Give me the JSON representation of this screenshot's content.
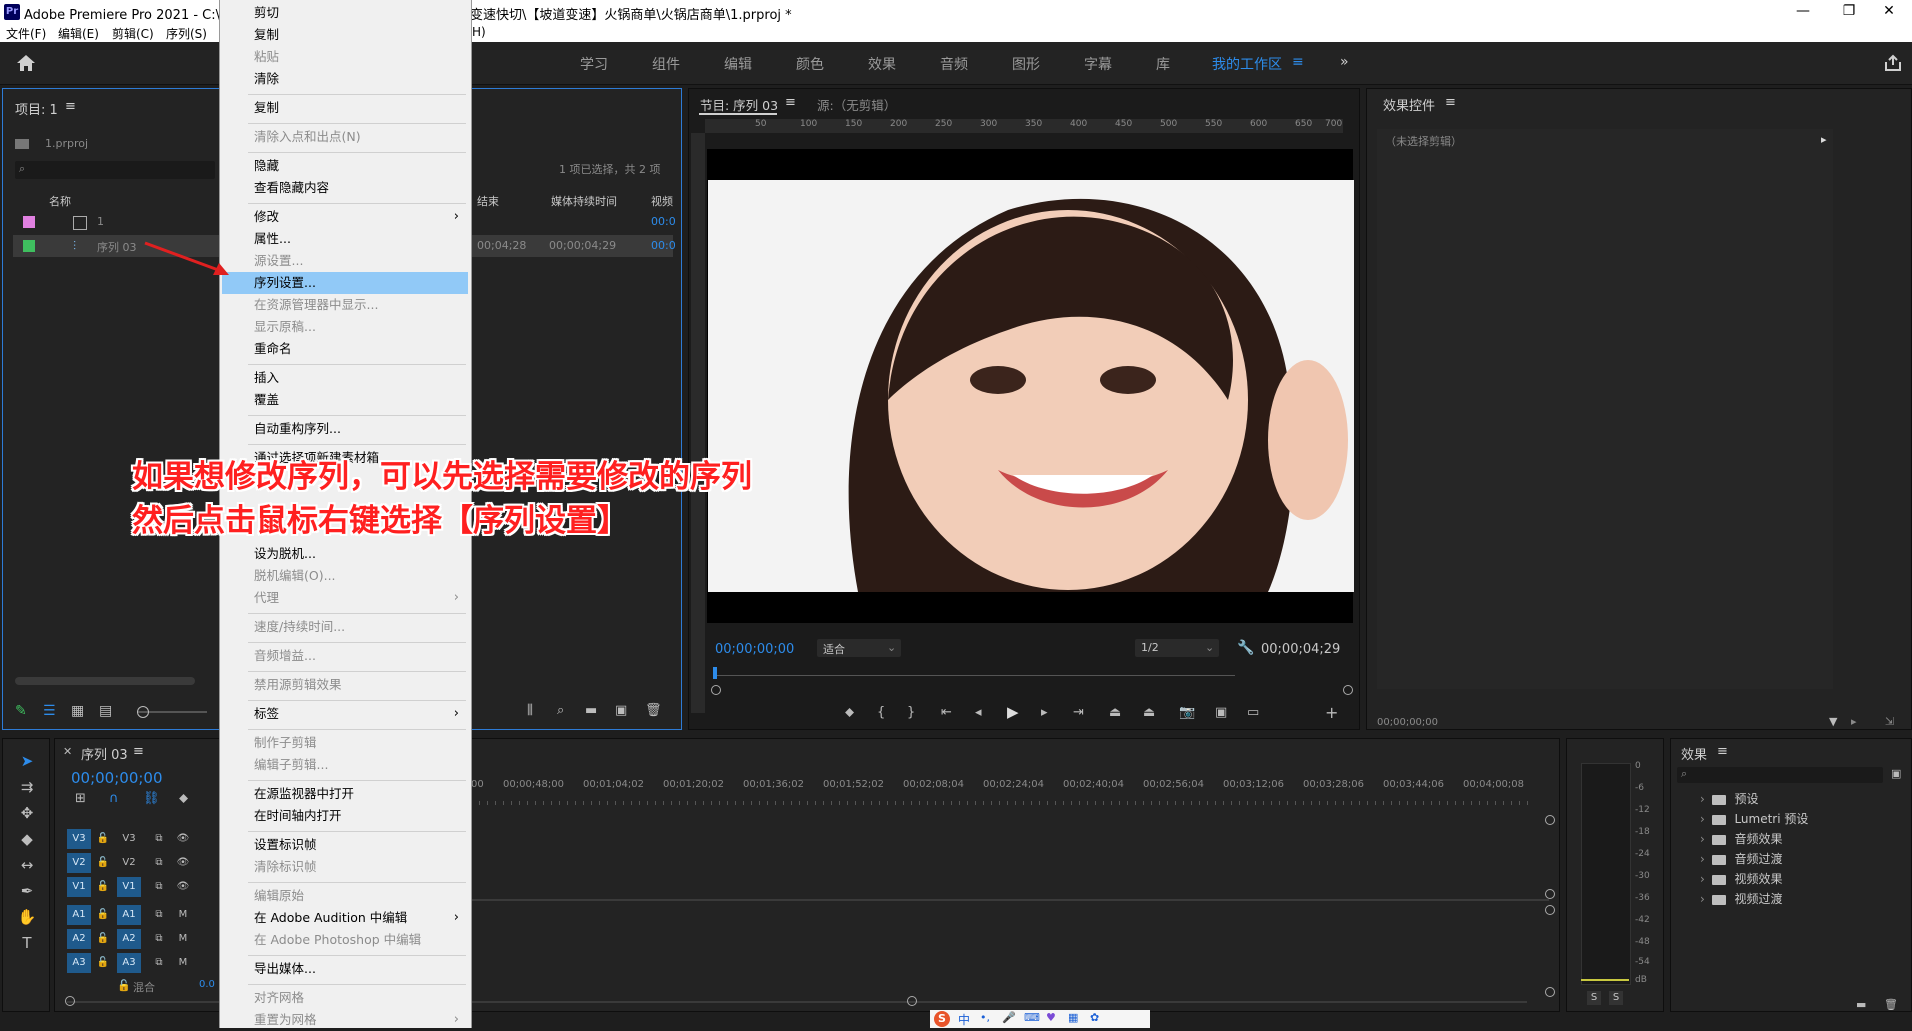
{
  "window": {
    "logo": "Pr",
    "title_left": "Adobe Premiere Pro 2021 - C:\\用/",
    "title_right": "变速快切\\【坡道变速】火锅商单\\火锅店商单\\1.prproj *",
    "minimize": "—",
    "maximize": "❐",
    "close": "✕"
  },
  "menubar": {
    "items": [
      "文件(F)",
      "编辑(E)",
      "剪辑(C)",
      "序列(S)"
    ],
    "partial_right": "H)"
  },
  "workspaces": {
    "items": [
      "学习",
      "组件",
      "编辑",
      "颜色",
      "效果",
      "音频",
      "图形",
      "字幕",
      "库"
    ],
    "active": "我的工作区",
    "menu_icon": "≡",
    "overflow": "»"
  },
  "project_panel": {
    "title": "项目: 1",
    "menu_icon": "≡",
    "file": "1.prproj",
    "selection_info": "1 项已选择，共 2 项",
    "columns": [
      "名称",
      "结束",
      "媒体持续时间",
      "视频"
    ],
    "rows": [
      {
        "name": "1",
        "color": "#e080e0",
        "end": "",
        "duration": "",
        "video": "00:0"
      },
      {
        "name": "序列 03",
        "color": "#3fbf5f",
        "end": "00;04;28",
        "duration": "00;00;04;29",
        "video": "00:0"
      }
    ]
  },
  "context_menu": {
    "items": [
      {
        "label": "剪切",
        "disabled": false
      },
      {
        "label": "复制",
        "disabled": false
      },
      {
        "label": "粘贴",
        "disabled": true
      },
      {
        "label": "清除",
        "disabled": false
      },
      {
        "label": "复制",
        "disabled": false
      },
      {
        "label": "清除入点和出点(N)",
        "disabled": true
      },
      {
        "label": "隐藏",
        "disabled": false
      },
      {
        "label": "查看隐藏内容",
        "disabled": false
      },
      {
        "label": "修改",
        "disabled": false,
        "submenu": true
      },
      {
        "label": "属性...",
        "disabled": false
      },
      {
        "label": "源设置...",
        "disabled": true
      },
      {
        "label": "序列设置...",
        "disabled": false,
        "highlighted": true
      },
      {
        "label": "在资源管理器中显示...",
        "disabled": true
      },
      {
        "label": "显示原稿...",
        "disabled": true
      },
      {
        "label": "重命名",
        "disabled": false
      },
      {
        "label": "插入",
        "disabled": false
      },
      {
        "label": "覆盖",
        "disabled": false
      },
      {
        "label": "自动重构序列...",
        "disabled": false
      },
      {
        "label": "通过选择项新建素材箱",
        "disabled": false
      },
      {
        "label": "设为脱机...",
        "disabled": false
      },
      {
        "label": "脱机编辑(O)...",
        "disabled": true
      },
      {
        "label": "代理",
        "disabled": true,
        "submenu": true
      },
      {
        "label": "速度/持续时间...",
        "disabled": true
      },
      {
        "label": "音频增益...",
        "disabled": true
      },
      {
        "label": "禁用源剪辑效果",
        "disabled": true
      },
      {
        "label": "标签",
        "disabled": false,
        "submenu": true
      },
      {
        "label": "制作子剪辑",
        "disabled": true
      },
      {
        "label": "编辑子剪辑...",
        "disabled": true
      },
      {
        "label": "在源监视器中打开",
        "disabled": false
      },
      {
        "label": "在时间轴内打开",
        "disabled": false
      },
      {
        "label": "设置标识帧",
        "disabled": false
      },
      {
        "label": "清除标识帧",
        "disabled": true
      },
      {
        "label": "编辑原始",
        "disabled": true
      },
      {
        "label": "在 Adobe Audition 中编辑",
        "disabled": false,
        "submenu": true
      },
      {
        "label": "在 Adobe Photoshop 中编辑",
        "disabled": true
      },
      {
        "label": "导出媒体...",
        "disabled": false
      },
      {
        "label": "对齐网格",
        "disabled": true
      },
      {
        "label": "重置为网格",
        "disabled": true,
        "submenu": true
      }
    ]
  },
  "annotation": {
    "line1": "如果想修改序列，可以先选择需要修改的序列",
    "line2": "然后点击鼠标右键选择【序列设置】"
  },
  "program_monitor": {
    "title": "节目: 序列 03",
    "menu_icon": "≡",
    "source_tab": "源:（无剪辑）",
    "ruler_labels": [
      "50",
      "100",
      "150",
      "200",
      "250",
      "300",
      "350",
      "400",
      "450",
      "500",
      "550",
      "600",
      "650",
      "700"
    ],
    "timecode": "00;00;00;00",
    "fit": "适合",
    "quality": "1/2",
    "duration": "00;00;04;29"
  },
  "effect_controls": {
    "title": "效果控件",
    "menu_icon": "≡",
    "empty": "（未选择剪辑）",
    "timecode": "00;00;00;00"
  },
  "timeline": {
    "title": "序列 03",
    "menu_icon": "≡",
    "timecode": "00;00;00;00",
    "ruler": [
      "00",
      "00;00;48;00",
      "00;01;04;02",
      "00;01;20;02",
      "00;01;36;02",
      "00;01;52;02",
      "00;02;08;04",
      "00;02;24;04",
      "00;02;40;04",
      "00;02;56;04",
      "00;03;12;06",
      "00;03;28;06",
      "00;03;44;06",
      "00;04;00;08"
    ],
    "video_tracks": [
      "V3",
      "V2",
      "V1"
    ],
    "audio_tracks": [
      "A3",
      "A2",
      "A1"
    ],
    "mix": "混合",
    "mix_value": "0.0",
    "mute": "M",
    "solo": "S"
  },
  "audio_meter": {
    "labels": [
      "0",
      "-6",
      "-12",
      "-18",
      "-24",
      "-30",
      "-36",
      "-42",
      "-48",
      "-54",
      "dB"
    ],
    "solo_left": "S",
    "solo_right": "S"
  },
  "effects_panel": {
    "title": "效果",
    "menu_icon": "≡",
    "items": [
      "预设",
      "Lumetri 预设",
      "音频效果",
      "音频过渡",
      "视频效果",
      "视频过渡"
    ]
  },
  "taskbar": {
    "ime": "中"
  },
  "colors": {
    "accent": "#2d8ceb",
    "panel": "#232323",
    "highlight": "#91c9f7",
    "annotation": "#ff2020"
  }
}
